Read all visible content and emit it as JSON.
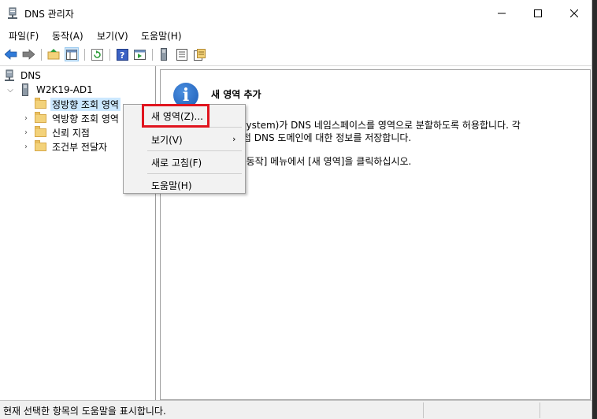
{
  "window": {
    "title": "DNS 관리자"
  },
  "menu": [
    "파일(F)",
    "동작(A)",
    "보기(V)",
    "도움말(H)"
  ],
  "tree": {
    "root": "DNS",
    "server": "W2K19-AD1",
    "children": [
      "정방향 조회 영역",
      "역방향 조회 영역",
      "신뢰 지점",
      "조건부 전달자"
    ]
  },
  "content": {
    "title": "새 영역 추가",
    "line1": "me System)가 DNS 네임스페이스를 영역으로 분할하도록 허용합니다. 각",
    "line2": "의 인접 DNS 도메인에 대한 정보를 저장합니다.",
    "line3": "려면 [동작] 메뉴에서 [새 영역]을 클릭하십시오."
  },
  "context_menu": {
    "new_zone": "새 영역(Z)...",
    "view": "보기(V)",
    "refresh": "새로 고침(F)",
    "help": "도움말(H)"
  },
  "status": {
    "text": "현재 선택한 항목의 도움말을 표시합니다."
  },
  "colors": {
    "highlight": "#e0141e",
    "selection": "#cce8ff",
    "info_icon": "#1d5bb5"
  }
}
